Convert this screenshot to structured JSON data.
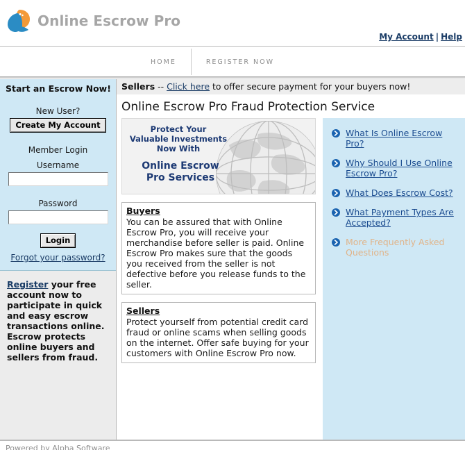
{
  "header": {
    "brand": "Online Escrow Pro",
    "logo_icon": "escrow-leaf-logo",
    "account_link": "My Account",
    "separator": "|",
    "help_link": "Help"
  },
  "nav": {
    "items": [
      {
        "label": "HOME",
        "name": "nav-home"
      },
      {
        "label": "REGISTER NOW",
        "name": "nav-register-now"
      }
    ]
  },
  "sidebar": {
    "title": "Start an Escrow Now!",
    "new_user_label": "New User?",
    "create_account_button": "Create My Account",
    "member_login_label": "Member Login",
    "username_label": "Username",
    "username_value": "",
    "username_placeholder": "",
    "password_label": "Password",
    "password_value": "",
    "password_placeholder": "",
    "login_button": "Login",
    "forgot_link": "Forgot your password?",
    "promo": {
      "link": "Register",
      "text": " your free account now to participate in quick and easy escrow transactions online. Escrow protects online buyers and sellers from fraud."
    }
  },
  "main": {
    "sellers_bar": {
      "prefix": "Sellers",
      "dashes": " -- ",
      "link": "Click here",
      "suffix": " to offer secure payment for your buyers now!"
    },
    "page_title": "Online Escrow Pro Fraud Protection Service",
    "banner": {
      "line1": "Protect Your",
      "line2": "Valuable Investments",
      "line3": "Now With",
      "line4": "Online Escrow",
      "line5": "Pro Services",
      "image_name": "globe-graphic"
    },
    "boxes": [
      {
        "heading": "Buyers",
        "body": "You can be assured that with Online Escrow Pro, you will receive your merchandise before seller is paid. Online Escrow Pro makes sure that the goods you received from the seller is not defective before you release funds to the seller."
      },
      {
        "heading": "Sellers",
        "body": "Protect yourself from potential credit card fraud or online scams when selling goods on the internet. Offer safe buying for your customers with Online Escrow Pro now."
      }
    ]
  },
  "faq": {
    "bullet_icon": "chevron-right-circle-icon",
    "items": [
      {
        "label": "What Is Online Escrow Pro?",
        "muted": false
      },
      {
        "label": "Why Should I Use Online Escrow Pro?",
        "muted": false
      },
      {
        "label": "What Does Escrow Cost?",
        "muted": false
      },
      {
        "label": "What Payment Types Are Accepted?",
        "muted": false
      },
      {
        "label": "More Frequently Asked Questions",
        "muted": true
      }
    ]
  },
  "footer": {
    "text": "Powered by Alpha Software"
  },
  "colors": {
    "panel_blue": "#cfe8f5",
    "panel_gray": "#ececec",
    "link_blue": "#1a3c66",
    "faq_link": "#1a4b8f",
    "faq_muted": "#e0b48a",
    "brand_gray": "#a6a6a6",
    "banner_navy": "#1d3a74",
    "logo_orange": "#f39a38",
    "logo_blue": "#2b8cc4"
  }
}
